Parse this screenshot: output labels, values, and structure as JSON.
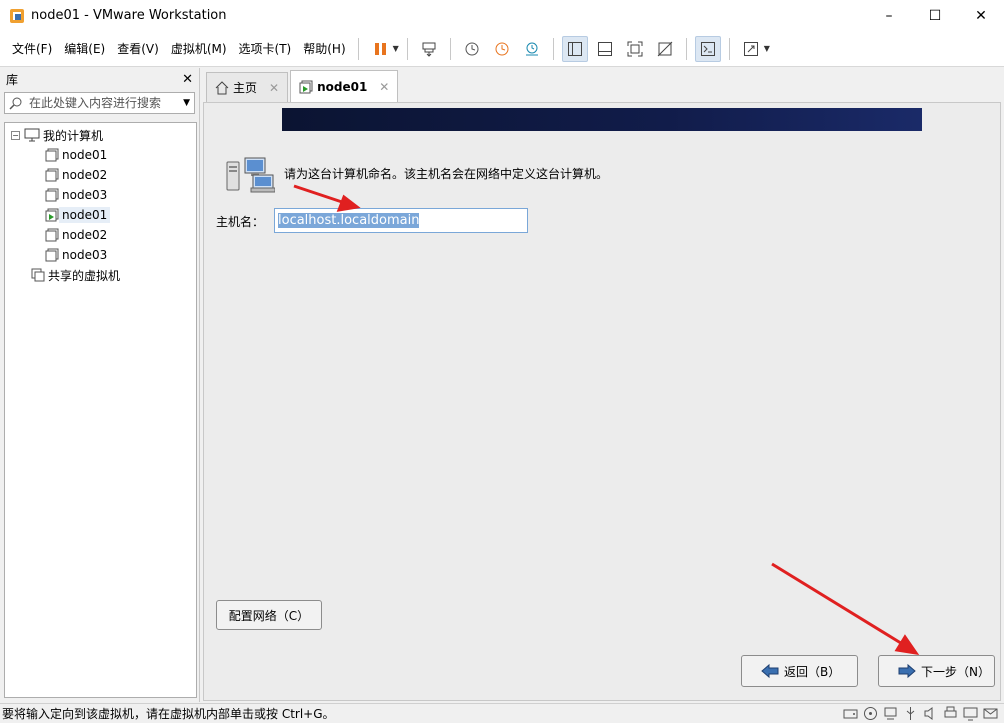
{
  "window": {
    "title": "node01 - VMware Workstation"
  },
  "menu": [
    "文件(F)",
    "编辑(E)",
    "查看(V)",
    "虚拟机(M)",
    "选项卡(T)",
    "帮助(H)"
  ],
  "library": {
    "title": "库",
    "search_placeholder": "在此处键入内容进行搜索",
    "root_label": "我的计算机",
    "items": [
      "node01",
      "node02",
      "node03",
      "node01",
      "node02",
      "node03"
    ],
    "shared_label": "共享的虚拟机"
  },
  "tabs": [
    {
      "label": "主页"
    },
    {
      "label": "node01"
    }
  ],
  "vm": {
    "prompt": "请为这台计算机命名。该主机名会在网络中定义这台计算机。",
    "hostname_label": "主机名：",
    "hostname_value": "localhost.localdomain",
    "configure_network_button": "配置网络（C）",
    "back_button": "返回（B）",
    "next_button": "下一步（N）"
  },
  "statusbar": {
    "text": "要将输入定向到该虚拟机，请在虚拟机内部单击或按 Ctrl+G。"
  },
  "colors": {
    "accent_orange": "#e8741e",
    "selection": "#7ba7d9",
    "annotation_red": "#e02020"
  }
}
